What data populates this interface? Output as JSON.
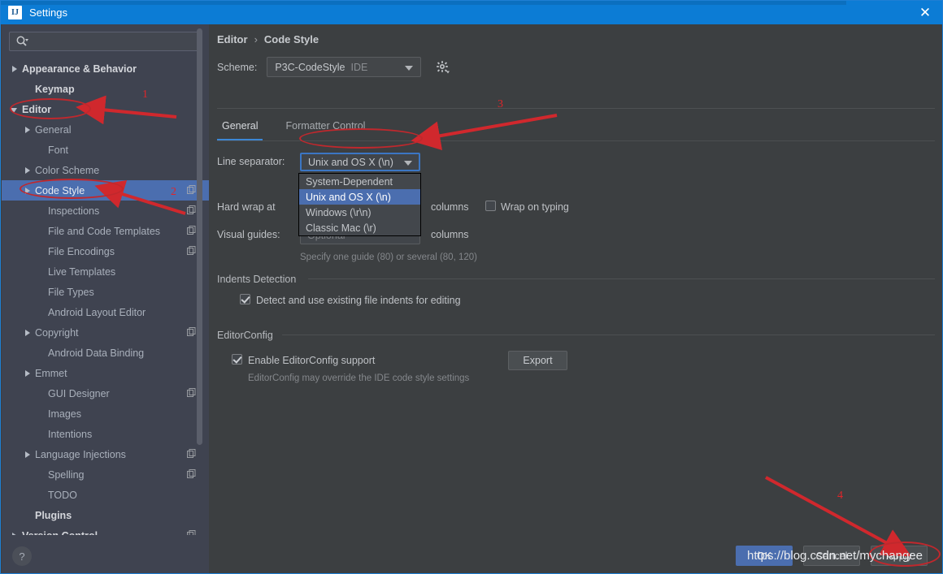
{
  "window": {
    "title": "Settings",
    "icon": "intellij-idea-icon",
    "close_label": "✕"
  },
  "search": {
    "value": "",
    "placeholder": "",
    "icon": "search-icon"
  },
  "sidebar": {
    "items": [
      {
        "label": "Appearance & Behavior",
        "indent": 0,
        "arrow": "right",
        "bold": true,
        "badge": false,
        "selected": false
      },
      {
        "label": "Keymap",
        "indent": 1,
        "arrow": "none",
        "bold": true,
        "badge": false,
        "selected": false
      },
      {
        "label": "Editor",
        "indent": 0,
        "arrow": "down",
        "bold": true,
        "badge": false,
        "selected": false
      },
      {
        "label": "General",
        "indent": 1,
        "arrow": "right",
        "bold": false,
        "badge": false,
        "selected": false
      },
      {
        "label": "Font",
        "indent": 2,
        "arrow": "none",
        "bold": false,
        "badge": false,
        "selected": false
      },
      {
        "label": "Color Scheme",
        "indent": 1,
        "arrow": "right",
        "bold": false,
        "badge": false,
        "selected": false
      },
      {
        "label": "Code Style",
        "indent": 1,
        "arrow": "right",
        "bold": false,
        "badge": true,
        "selected": true
      },
      {
        "label": "Inspections",
        "indent": 2,
        "arrow": "none",
        "bold": false,
        "badge": true,
        "selected": false
      },
      {
        "label": "File and Code Templates",
        "indent": 2,
        "arrow": "none",
        "bold": false,
        "badge": true,
        "selected": false
      },
      {
        "label": "File Encodings",
        "indent": 2,
        "arrow": "none",
        "bold": false,
        "badge": true,
        "selected": false
      },
      {
        "label": "Live Templates",
        "indent": 2,
        "arrow": "none",
        "bold": false,
        "badge": false,
        "selected": false
      },
      {
        "label": "File Types",
        "indent": 2,
        "arrow": "none",
        "bold": false,
        "badge": false,
        "selected": false
      },
      {
        "label": "Android Layout Editor",
        "indent": 2,
        "arrow": "none",
        "bold": false,
        "badge": false,
        "selected": false
      },
      {
        "label": "Copyright",
        "indent": 1,
        "arrow": "right",
        "bold": false,
        "badge": true,
        "selected": false
      },
      {
        "label": "Android Data Binding",
        "indent": 2,
        "arrow": "none",
        "bold": false,
        "badge": false,
        "selected": false
      },
      {
        "label": "Emmet",
        "indent": 1,
        "arrow": "right",
        "bold": false,
        "badge": false,
        "selected": false
      },
      {
        "label": "GUI Designer",
        "indent": 2,
        "arrow": "none",
        "bold": false,
        "badge": true,
        "selected": false
      },
      {
        "label": "Images",
        "indent": 2,
        "arrow": "none",
        "bold": false,
        "badge": false,
        "selected": false
      },
      {
        "label": "Intentions",
        "indent": 2,
        "arrow": "none",
        "bold": false,
        "badge": false,
        "selected": false
      },
      {
        "label": "Language Injections",
        "indent": 1,
        "arrow": "right",
        "bold": false,
        "badge": true,
        "selected": false
      },
      {
        "label": "Spelling",
        "indent": 2,
        "arrow": "none",
        "bold": false,
        "badge": true,
        "selected": false
      },
      {
        "label": "TODO",
        "indent": 2,
        "arrow": "none",
        "bold": false,
        "badge": false,
        "selected": false
      },
      {
        "label": "Plugins",
        "indent": 1,
        "arrow": "none",
        "bold": true,
        "badge": false,
        "selected": false
      },
      {
        "label": "Version Control",
        "indent": 0,
        "arrow": "right",
        "bold": true,
        "badge": true,
        "selected": false
      }
    ],
    "help_label": "?"
  },
  "main": {
    "breadcrumb": {
      "parent": "Editor",
      "separator": "›",
      "current": "Code Style"
    },
    "scheme": {
      "label": "Scheme:",
      "value": "P3C-CodeStyle",
      "scope": "IDE",
      "gear_icon": "gear-icon"
    },
    "tabs": [
      {
        "label": "General",
        "active": true
      },
      {
        "label": "Formatter Control",
        "active": false
      }
    ],
    "line_separator": {
      "label": "Line separator:",
      "value": "Unix and OS X (\\n)",
      "options": [
        {
          "label": "System-Dependent",
          "selected": false
        },
        {
          "label": "Unix and OS X (\\n)",
          "selected": true
        },
        {
          "label": "Windows (\\r\\n)",
          "selected": false
        },
        {
          "label": "Classic Mac (\\r)",
          "selected": false
        }
      ]
    },
    "hard_wrap": {
      "label": "Hard wrap at",
      "suffix": "columns"
    },
    "wrap_on_typing": {
      "label": "Wrap on typing",
      "checked": false
    },
    "visual_guides": {
      "label": "Visual guides:",
      "placeholder": "Optional",
      "suffix": "columns",
      "hint": "Specify one guide (80) or several (80, 120)"
    },
    "indents_detection": {
      "title": "Indents Detection",
      "checkbox_label": "Detect and use existing file indents for editing",
      "checked": true
    },
    "editorconfig": {
      "title": "EditorConfig",
      "checkbox_label": "Enable EditorConfig support",
      "checked": true,
      "export_label": "Export",
      "note": "EditorConfig may override the IDE code style settings"
    }
  },
  "footer": {
    "ok_label": "OK",
    "cancel_label": "Cancel",
    "apply_label": "Apply"
  },
  "annotations": {
    "numbers": [
      "1",
      "2",
      "3",
      "4"
    ],
    "watermark": "https://blog.csdn.net/mychangee",
    "color": "#d0282d"
  }
}
